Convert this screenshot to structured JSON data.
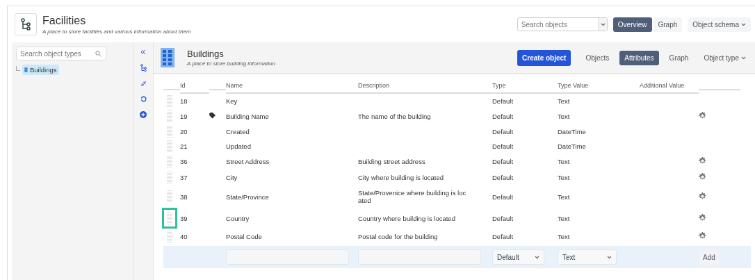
{
  "schema": {
    "title": "Facilities",
    "subtitle": "A place to store facilities and various information about them"
  },
  "top_nav": {
    "search": {
      "placeholder": "Search objects"
    },
    "tabs": [
      {
        "label": "Overview",
        "selected": true
      },
      {
        "label": "Graph",
        "selected": false
      }
    ],
    "menu": "Object schema"
  },
  "sidebar": {
    "search": {
      "placeholder": "Search object types"
    },
    "tree": [
      {
        "label": "Buildings",
        "selected": true
      }
    ]
  },
  "object_type": {
    "title": "Buildings",
    "subtitle": "A place to store building information",
    "create_button": "Create object",
    "tabs": [
      {
        "label": "Objects",
        "selected": false
      },
      {
        "label": "Attributes",
        "selected": true
      },
      {
        "label": "Graph",
        "selected": false
      }
    ],
    "menu": "Object type"
  },
  "table": {
    "columns": [
      "Id",
      "Name",
      "Description",
      "Type",
      "Type Value",
      "Additional Value"
    ],
    "rows": [
      {
        "id": "18",
        "name": "Key",
        "description": "",
        "type": "Default",
        "type_value": "Text",
        "label": false,
        "configurable": false,
        "highlighted": false
      },
      {
        "id": "19",
        "name": "Building Name",
        "description": "The name of the building",
        "type": "Default",
        "type_value": "Text",
        "label": true,
        "configurable": true,
        "highlighted": false
      },
      {
        "id": "20",
        "name": "Created",
        "description": "",
        "type": "Default",
        "type_value": "DateTime",
        "label": false,
        "configurable": false,
        "highlighted": false
      },
      {
        "id": "21",
        "name": "Updated",
        "description": "",
        "type": "Default",
        "type_value": "DateTime",
        "label": false,
        "configurable": false,
        "highlighted": false
      },
      {
        "id": "36",
        "name": "Street Address",
        "description": "Building street address",
        "type": "Default",
        "type_value": "Text",
        "label": false,
        "configurable": true,
        "highlighted": false
      },
      {
        "id": "37",
        "name": "City",
        "description": "City where building is located",
        "type": "Default",
        "type_value": "Text",
        "label": false,
        "configurable": true,
        "highlighted": false
      },
      {
        "id": "38",
        "name": "State/Province",
        "description": "State/Provenice where building is located",
        "type": "Default",
        "type_value": "Text",
        "label": false,
        "configurable": true,
        "highlighted": false
      },
      {
        "id": "39",
        "name": "Country",
        "description": "Country where building is located",
        "type": "Default",
        "type_value": "Text",
        "label": false,
        "configurable": true,
        "highlighted": true
      },
      {
        "id": "40",
        "name": "Postal Code",
        "description": "Postal code for the building",
        "type": "Default",
        "type_value": "Text",
        "label": false,
        "configurable": true,
        "highlighted": false
      }
    ],
    "add_row": {
      "type": "Default",
      "type_value": "Text",
      "button": "Add"
    }
  }
}
